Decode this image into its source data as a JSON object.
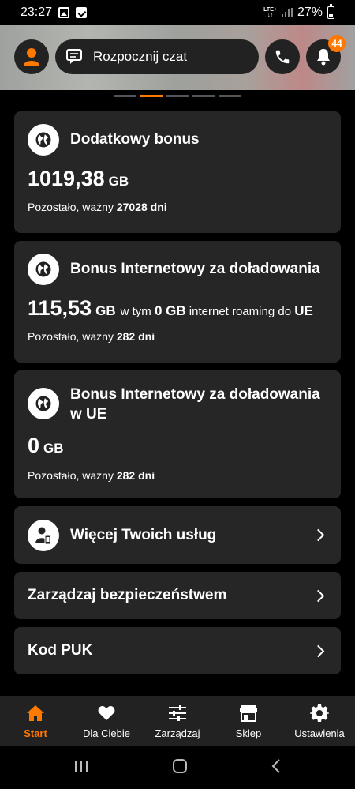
{
  "status_bar": {
    "time": "23:27",
    "network": "LTE+",
    "battery": "27%"
  },
  "header": {
    "chat_label": "Rozpocznij czat",
    "notification_count": "44"
  },
  "cards": [
    {
      "title": "Dodatkowy bonus",
      "amount": "1019,38",
      "unit": "GB",
      "validity_prefix": "Pozostało, ważny",
      "validity_value": "27028 dni"
    },
    {
      "title": "Bonus Internetowy za doładowania",
      "amount": "115,53",
      "unit": "GB",
      "extra_prefix": "w tym",
      "extra_value": "0 GB",
      "extra_mid": "internet roaming do",
      "extra_suffix": "UE",
      "validity_prefix": "Pozostało, ważny",
      "validity_value": "282 dni"
    },
    {
      "title_line1": "Bonus Internetowy za doładowania",
      "title_line2": "w UE",
      "amount": "0",
      "unit": "GB",
      "validity_prefix": "Pozostało, ważny",
      "validity_value": "282 dni"
    }
  ],
  "links": {
    "more_services": "Więcej Twoich usług",
    "security": "Zarządzaj bezpieczeństwem",
    "puk": "Kod PUK"
  },
  "bottom_nav": [
    {
      "label": "Start",
      "icon": "home-icon",
      "active": true
    },
    {
      "label": "Dla Ciebie",
      "icon": "heart-icon"
    },
    {
      "label": "Zarządzaj",
      "icon": "sliders-icon"
    },
    {
      "label": "Sklep",
      "icon": "store-icon"
    },
    {
      "label": "Ustawienia",
      "icon": "gear-icon"
    }
  ],
  "colors": {
    "accent": "#ff7900",
    "card_bg": "#262626",
    "background": "#000000"
  }
}
